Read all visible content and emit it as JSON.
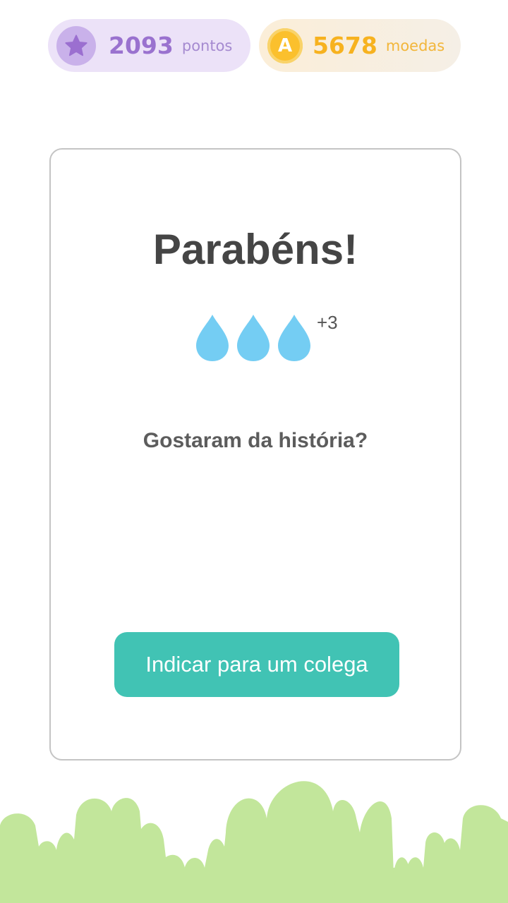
{
  "header": {
    "points": {
      "value": "2093",
      "unit": "pontos",
      "icon": "star-icon"
    },
    "coins": {
      "value": "5678",
      "unit": "moedas",
      "icon": "coin-icon",
      "coin_letter": "A"
    }
  },
  "card": {
    "title": "Parabéns!",
    "reward": {
      "icon": "water-drop-icon",
      "drop_count": 3,
      "label": "+3"
    },
    "question": "Gostaram da história?",
    "share_button_label": "Indicar para um colega"
  },
  "colors": {
    "points_accent": "#9a72cf",
    "coins_accent": "#f7b21f",
    "drop": "#74cdf3",
    "button": "#41c3b4",
    "grass": "#c2e69b"
  }
}
